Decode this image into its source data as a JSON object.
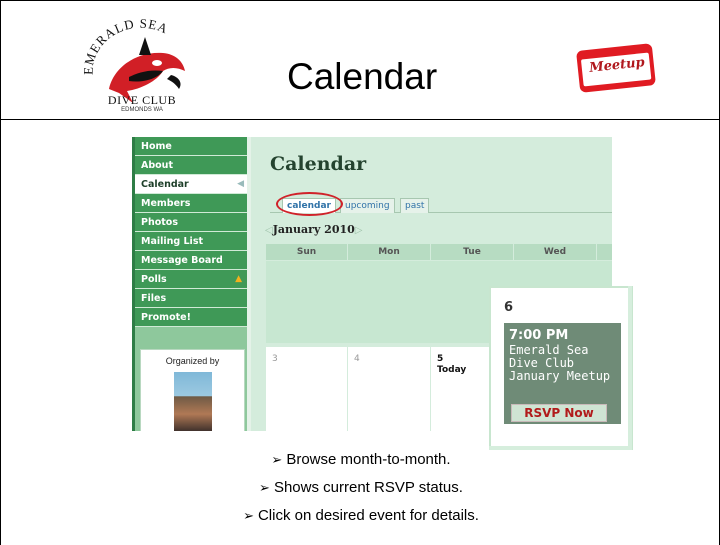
{
  "slide": {
    "title": "Calendar",
    "logo": {
      "arc_text": "EMERALD SEA",
      "name": "DIVE CLUB",
      "location": "EDMONDS WA"
    },
    "meetup_badge": "Meetup",
    "bullets": [
      "Browse month-to-month.",
      "Shows current RSVP status.",
      "Click on desired event for details."
    ]
  },
  "screenshot": {
    "sidebar": {
      "items": [
        {
          "label": "Home"
        },
        {
          "label": "About"
        },
        {
          "label": "Calendar"
        },
        {
          "label": "Members"
        },
        {
          "label": "Photos"
        },
        {
          "label": "Mailing List"
        },
        {
          "label": "Message Board"
        },
        {
          "label": "Polls"
        },
        {
          "label": "Files"
        },
        {
          "label": "Promote!"
        }
      ],
      "active": "Calendar",
      "organized_by": "Organized by"
    },
    "main": {
      "title": "Calendar",
      "tabs": [
        {
          "label": "calendar"
        },
        {
          "label": "upcoming"
        },
        {
          "label": "past"
        }
      ],
      "active_tab": "calendar",
      "month": "January 2010",
      "day_headers": [
        "Sun",
        "Mon",
        "Tue",
        "Wed"
      ],
      "cells": [
        {
          "num": "3"
        },
        {
          "num": "4"
        },
        {
          "num": "5",
          "note": "Today"
        }
      ]
    },
    "popup": {
      "date": "6",
      "time": "7:00 PM",
      "event_title": "Emerald Sea Dive Club January Meetup",
      "rsvp_label": "RSVP Now"
    }
  },
  "colors": {
    "nav_green": "#3f9957",
    "sidebar_green": "#8ec89c",
    "panel_green": "#d4ecdc",
    "highlight_red": "#d0222a"
  },
  "icons": {
    "bullet": "arrow-bullet-icon",
    "prev_month": "prev-month-arrow-icon",
    "next_month": "next-month-arrow-icon",
    "poll_alert": "warning-icon"
  }
}
